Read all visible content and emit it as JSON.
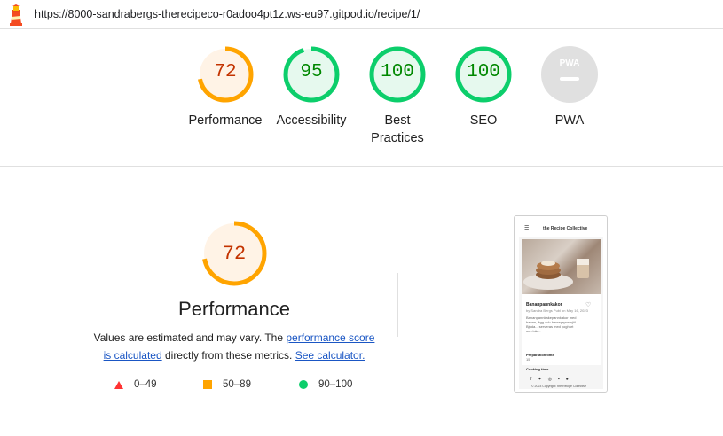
{
  "url_bar": {
    "url": "https://8000-sandrabergs-therecipeco-r0adoo4pt1z.ws-eu97.gitpod.io/recipe/1/"
  },
  "colors": {
    "average": "#ffa400",
    "average_text": "#c33300",
    "average_fill": "#fff3e6",
    "pass": "#0cce6b",
    "pass_text": "#008800",
    "pass_fill": "#e6f9ee",
    "fail": "#ff3333",
    "na": "#e0e0e0",
    "link": "#1a56c4"
  },
  "categories": [
    {
      "label": "Performance",
      "score": "72",
      "fraction": 0.72,
      "rating": "average"
    },
    {
      "label": "Accessibility",
      "score": "95",
      "fraction": 0.95,
      "rating": "pass"
    },
    {
      "label": "Best Practices",
      "score": "100",
      "fraction": 1.0,
      "rating": "pass"
    },
    {
      "label": "SEO",
      "score": "100",
      "fraction": 1.0,
      "rating": "pass"
    },
    {
      "label": "PWA",
      "badge": "PWA",
      "rating": "na"
    }
  ],
  "performance": {
    "score": "72",
    "fraction": 0.72,
    "title": "Performance",
    "desc_prefix": "Values are estimated and may vary. The ",
    "link_score": "performance score",
    "link_calculated": "is calculated",
    "desc_middle": " directly from these metrics. ",
    "link_calculator": "See calculator."
  },
  "legend": [
    {
      "shape": "triangle",
      "range": "0–49"
    },
    {
      "shape": "square",
      "range": "50–89"
    },
    {
      "shape": "circle",
      "range": "90–100"
    }
  ],
  "thumbnail": {
    "site_title": "the Recipe Collective",
    "recipe_title": "Bananpannkakor",
    "byline": "by Sandra Bergs  Publ on May 16, 2023",
    "description": "Bananpannkakepannkakor med banan, ägg och havregrynsmjöl. Bjuda... serveras med yoghurt och bär...",
    "prep_heading": "Preparation time",
    "prep_value": "15",
    "cook_heading": "Cooking time",
    "copyright": "© 2023 Copyright: the Recipe Collective"
  }
}
